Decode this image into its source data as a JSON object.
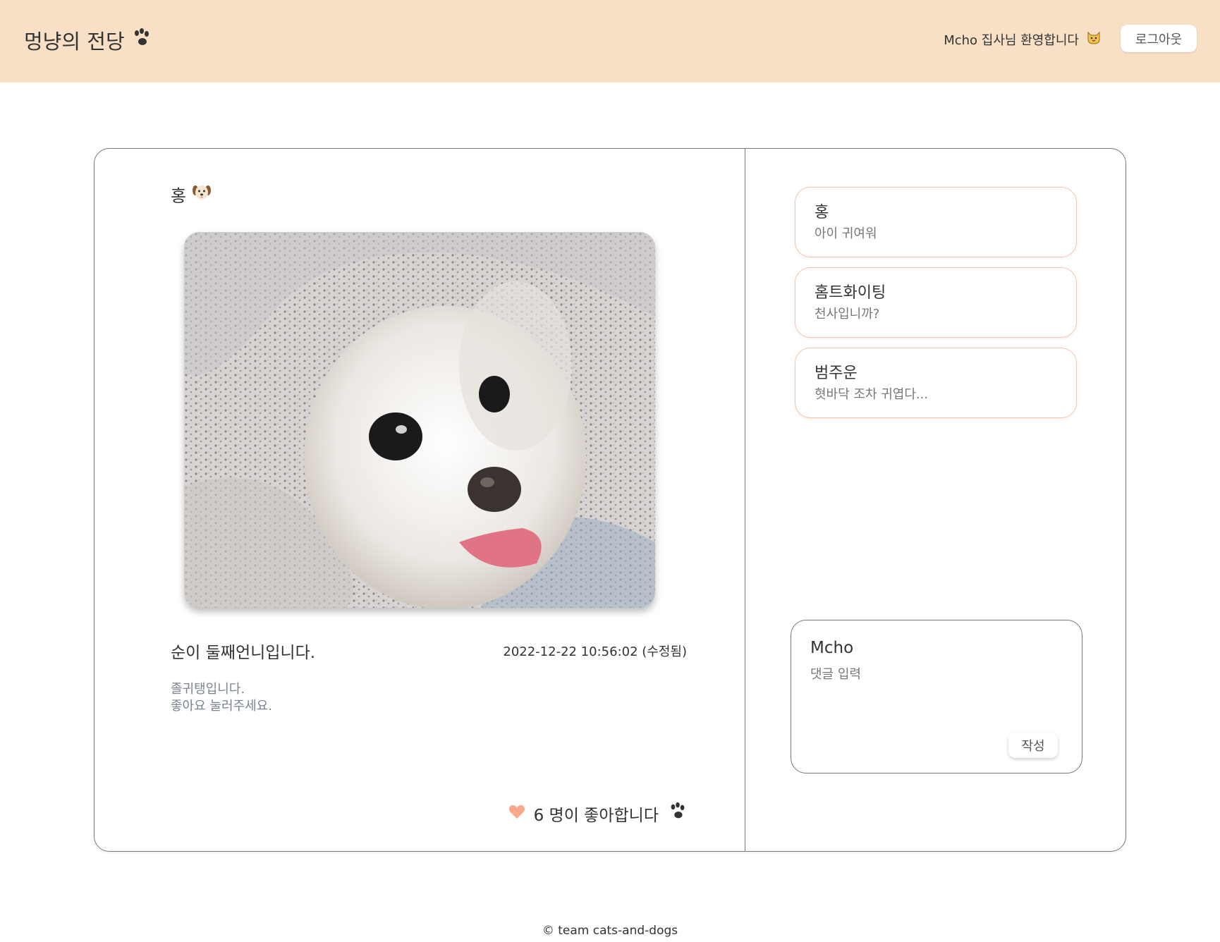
{
  "header": {
    "logo_text": "멍냥의 전당",
    "logo_icon": "paw-icon",
    "welcome_text": "Mcho 집사님 환영합니다",
    "welcome_icon": "cat-face-icon",
    "logout_label": "로그아웃",
    "background_color": "#f7e0c5"
  },
  "post": {
    "author": "홍",
    "author_icon": "dog-face-icon",
    "title": "순이 둘째언니입니다.",
    "date": "2022-12-22 10:56:02 (수정됨)",
    "body_lines": [
      "졸귀탱입니다.",
      "좋아요 눌러주세요."
    ],
    "likes_text": "6 명이 좋아합니다",
    "like_icon": "heart-icon",
    "like_color": "#f7a98a"
  },
  "comments": [
    {
      "author": "홍",
      "text": "아이 귀여워"
    },
    {
      "author": "홈트화이팅",
      "text": "천사입니까?"
    },
    {
      "author": "범주운",
      "text": "혓바닥 조차 귀엽다..."
    }
  ],
  "compose": {
    "user": "Mcho",
    "placeholder": "댓글 입력",
    "submit_label": "작성"
  },
  "footer": {
    "text": "© team cats-and-dogs"
  }
}
